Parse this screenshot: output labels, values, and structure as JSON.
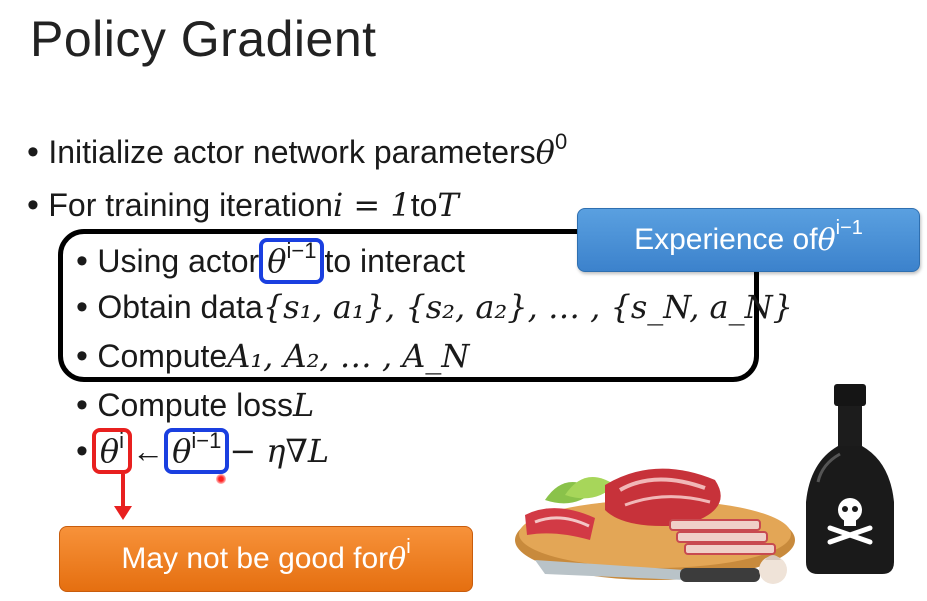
{
  "slide": {
    "title": "Policy Gradient",
    "bullets": [
      {
        "text": "Initialize actor network parameters ",
        "math_base": "θ",
        "math_sup": "0"
      },
      {
        "text": "For training iteration ",
        "math": "i = 1",
        "tail": " to ",
        "math2": "T"
      }
    ],
    "sub_bullets": {
      "b1_prefix": "Using actor ",
      "b1_theta": "θ",
      "b1_sup": "i−1",
      "b1_suffix": " to interact",
      "b2_prefix": "Obtain data ",
      "b2_math": "{s₁, a₁}, {s₂, a₂}, … , {s_N, a_N}",
      "b3_prefix": "Compute ",
      "b3_math": "A₁, A₂, … , A_N",
      "b4_prefix": "Compute loss ",
      "b4_math": "L",
      "b5_theta_new": "θ",
      "b5_theta_new_sup": "i",
      "b5_arrow": " ← ",
      "b5_theta_old": "θ",
      "b5_theta_old_sup": "i−1",
      "b5_tail": " − η∇L"
    },
    "callouts": {
      "experience": "Experience of ",
      "experience_theta": "θ",
      "experience_sup": "i−1",
      "warning": "May not be good for ",
      "warning_theta": "θ",
      "warning_sup": "i"
    },
    "images": [
      "meat-board-image",
      "poison-bottle-image"
    ],
    "colors": {
      "blue_box": "#1a3fe0",
      "red_box": "#e8201f",
      "experience_bg": "#4a90d9",
      "warning_bg": "#ef7d22"
    }
  }
}
